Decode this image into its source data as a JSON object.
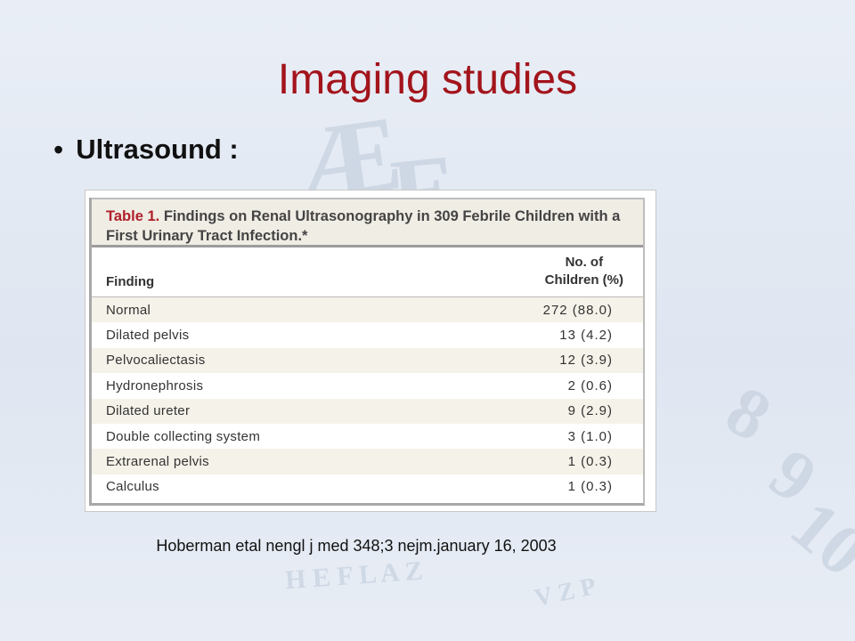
{
  "slide": {
    "title": "Imaging studies",
    "bullet": "Ultrasound :",
    "citation": "Hoberman etal nengl j med 348;3 nejm.january 16, 2003"
  },
  "table": {
    "caption_label": "Table 1.",
    "caption_text": "Findings on Renal Ultrasonography in 309 Febrile Children with a First Urinary Tract Infection.*",
    "header": {
      "finding": "Finding",
      "count_line1": "No. of",
      "count_line2": "Children (%)"
    },
    "rows": [
      {
        "finding": "Normal",
        "count": "272 (88.0)"
      },
      {
        "finding": "Dilated pelvis",
        "count": "13 (4.2)"
      },
      {
        "finding": "Pelvocaliectasis",
        "count": "12 (3.9)"
      },
      {
        "finding": "Hydronephrosis",
        "count": "2 (0.6)"
      },
      {
        "finding": "Dilated ureter",
        "count": "9 (2.9)"
      },
      {
        "finding": "Double collecting system",
        "count": "3 (1.0)"
      },
      {
        "finding": "Extrarenal pelvis",
        "count": "1 (0.3)"
      },
      {
        "finding": "Calculus",
        "count": "1 (0.3)"
      }
    ]
  },
  "colors": {
    "title": "#a3141c",
    "caption_label": "#b0202a",
    "row_shade": "#f5f2e9"
  }
}
